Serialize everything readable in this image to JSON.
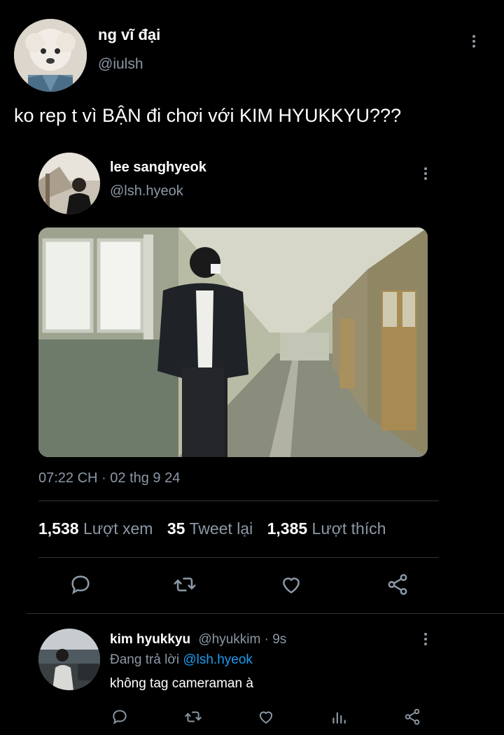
{
  "outer_tweet": {
    "author_name": "ng vĩ đại",
    "author_handle": "@iulsh",
    "text": "ko rep t vì BẬN đi chơi với KIM HYUKKYU???"
  },
  "quoted_tweet": {
    "author_name": "lee sanghyeok",
    "author_handle": "@lsh.hyeok",
    "timestamp": "07:22 CH · 02 thg 9 24",
    "stats": {
      "views_count": "1,538",
      "views_label": "Lượt xem",
      "retweets_count": "35",
      "retweets_label": "Tweet lại",
      "likes_count": "1,385",
      "likes_label": "Lượt thích"
    },
    "actions": [
      "reply-icon",
      "retweet-icon",
      "like-icon",
      "share-icon"
    ]
  },
  "reply": {
    "author_name": "kim hyukkyu",
    "author_handle_time": "@hyukkim · 9s",
    "replying_prefix": "Đang trả lời",
    "replying_to": "@lsh.hyeok",
    "text": "không tag cameraman à",
    "actions": [
      "reply-icon",
      "retweet-icon",
      "like-icon",
      "analytics-icon",
      "share-icon"
    ]
  },
  "colors": {
    "background": "#000000",
    "text": "#e7e9ea",
    "muted": "#8b98a5",
    "link": "#1d9bf0",
    "divider": "#2f3336"
  }
}
